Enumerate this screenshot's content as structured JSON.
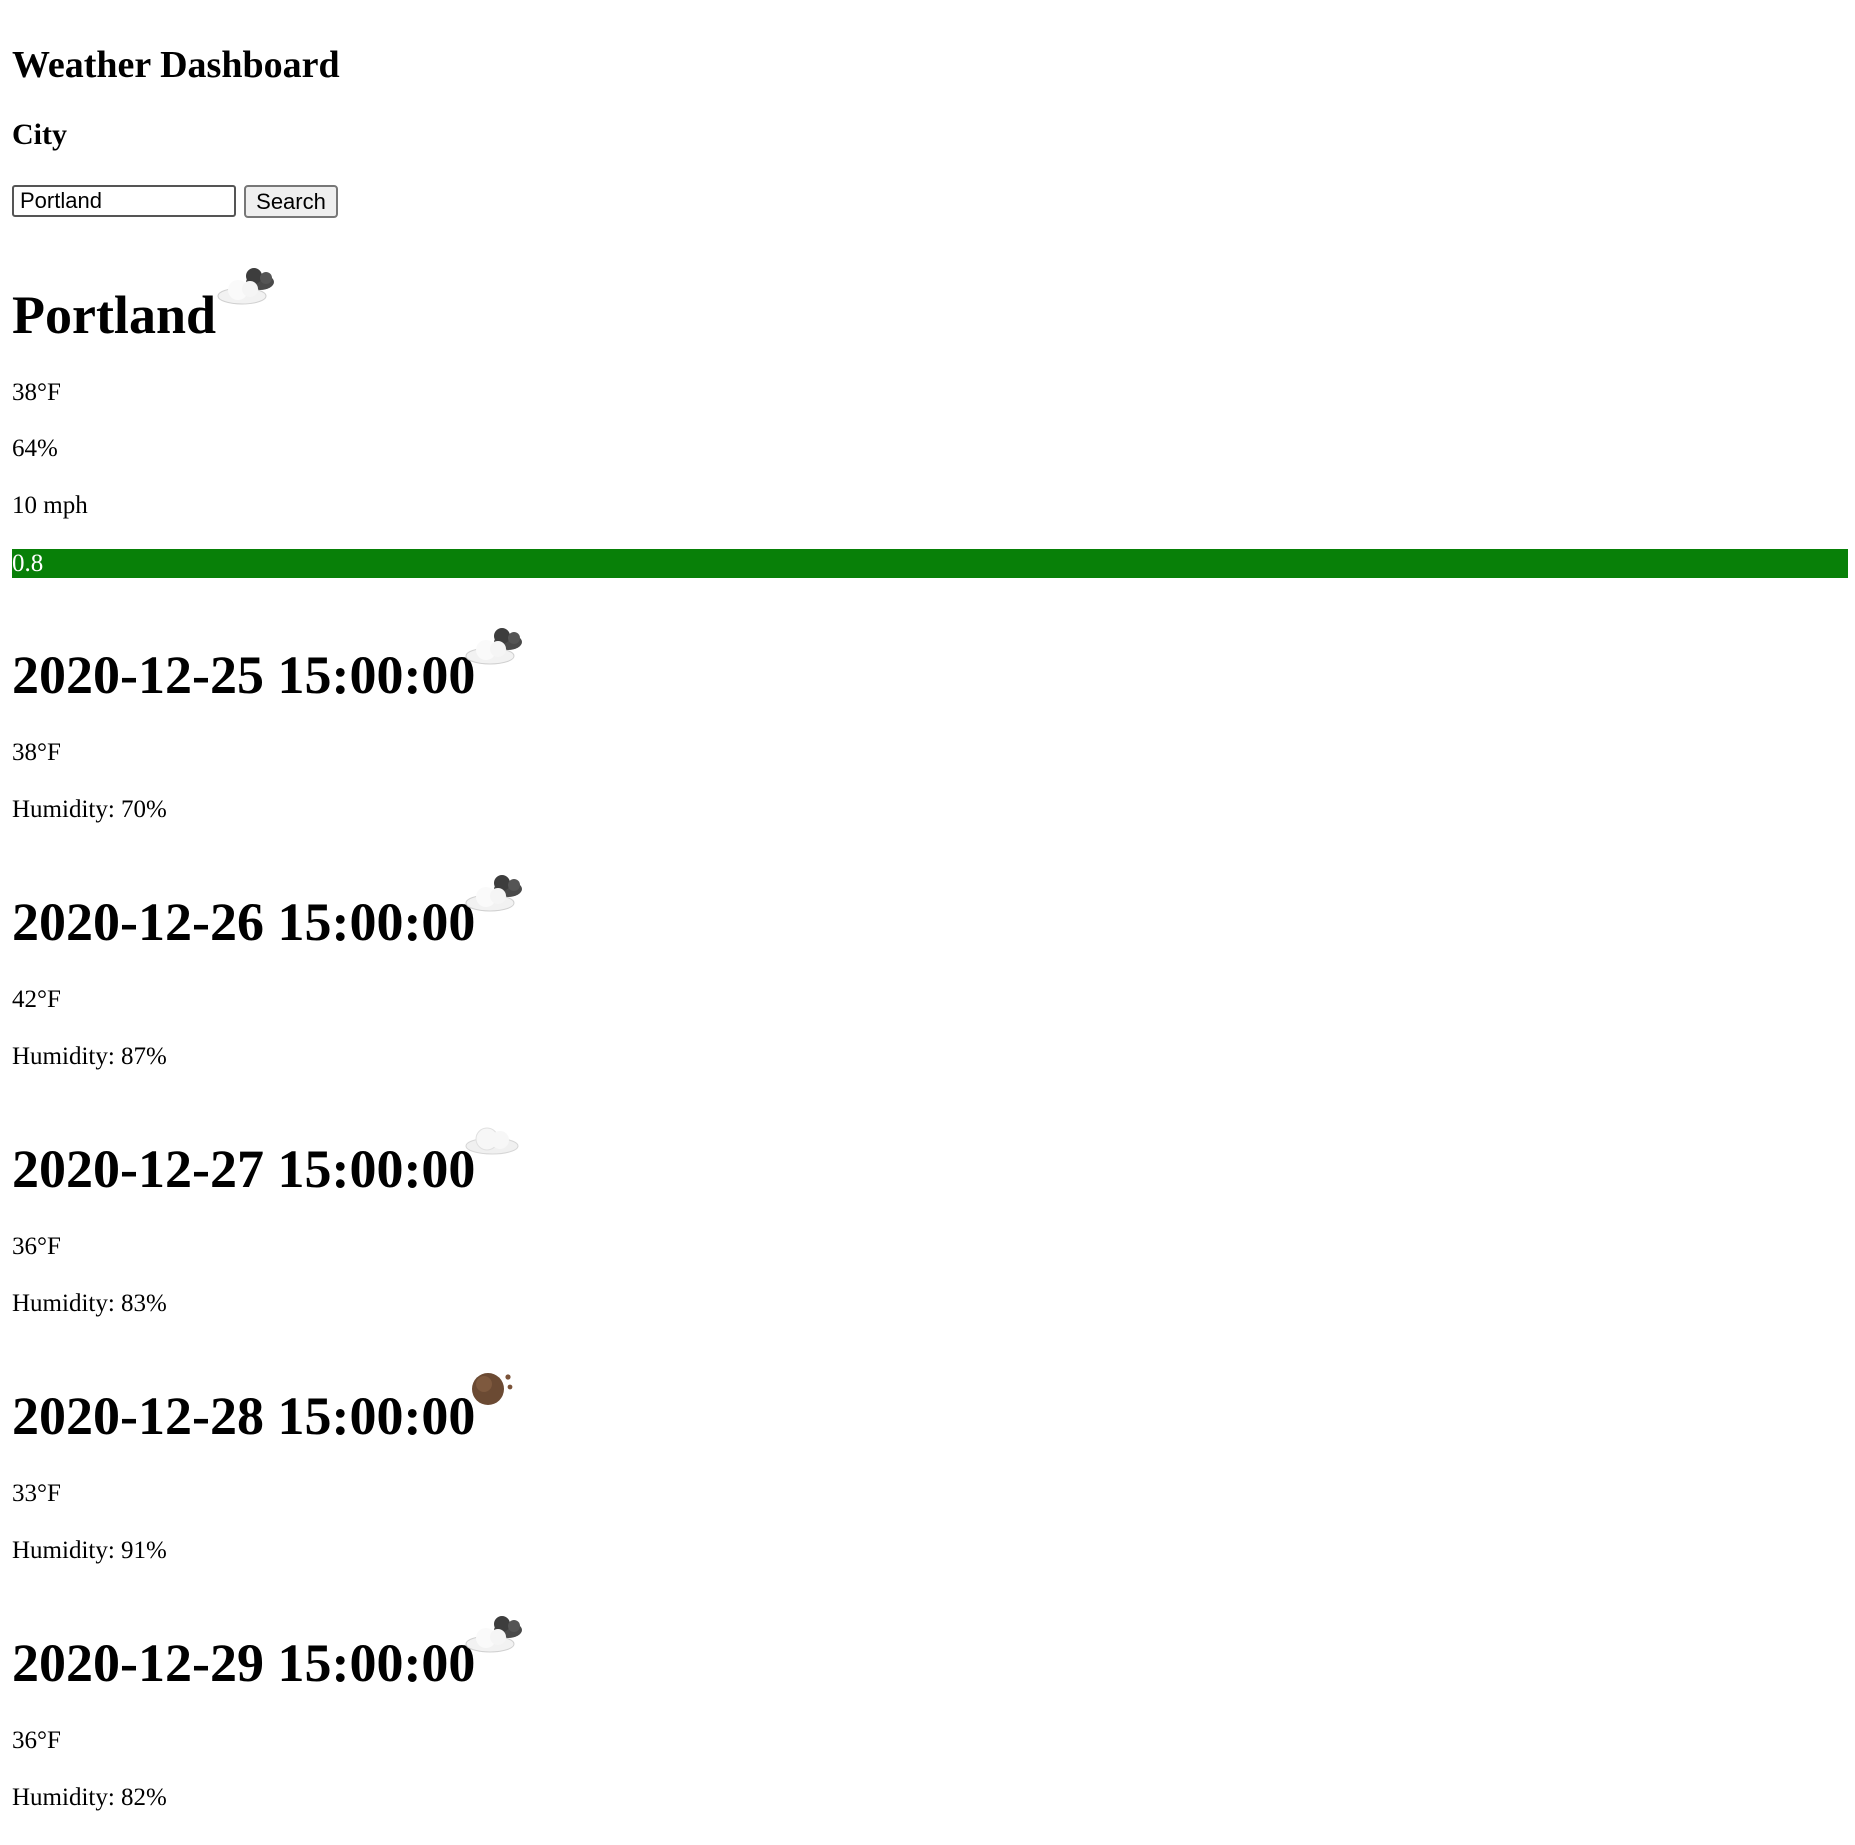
{
  "app": {
    "title": "Weather Dashboard"
  },
  "search": {
    "label": "City",
    "value": "Portland",
    "button_label": "Search"
  },
  "current": {
    "city": "Portland",
    "icon": "partly-cloudy-icon",
    "temperature": "38°F",
    "humidity": "64%",
    "wind": "10 mph",
    "progress_value": 0.8,
    "progress_label": "0.8",
    "progress_color": "#088008"
  },
  "forecast": [
    {
      "date": "2020-12-25 15:00:00",
      "icon": "partly-cloudy-icon",
      "temperature": "38°F",
      "humidity": "Humidity: 70%"
    },
    {
      "date": "2020-12-26 15:00:00",
      "icon": "partly-cloudy-icon",
      "temperature": "42°F",
      "humidity": "Humidity: 87%"
    },
    {
      "date": "2020-12-27 15:00:00",
      "icon": "cloud-icon",
      "temperature": "36°F",
      "humidity": "Humidity: 83%"
    },
    {
      "date": "2020-12-28 15:00:00",
      "icon": "rain-drop-icon",
      "temperature": "33°F",
      "humidity": "Humidity: 91%"
    },
    {
      "date": "2020-12-29 15:00:00",
      "icon": "partly-cloudy-icon",
      "temperature": "36°F",
      "humidity": "Humidity: 82%"
    }
  ]
}
